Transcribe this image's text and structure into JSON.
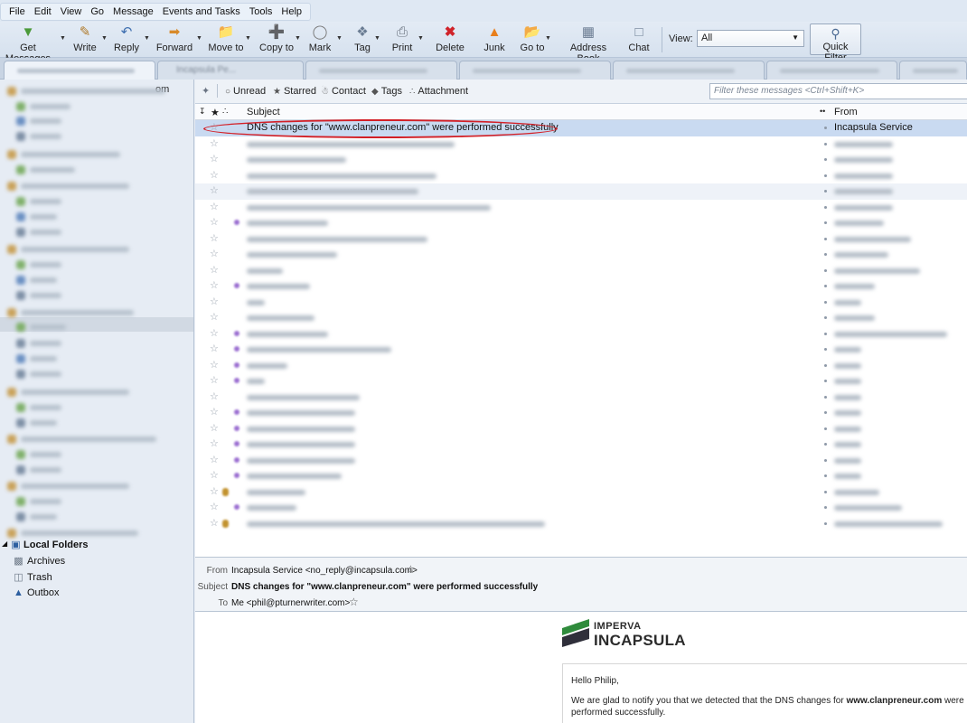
{
  "menus": [
    "File",
    "Edit",
    "View",
    "Go",
    "Message",
    "Events and Tasks",
    "Tools",
    "Help"
  ],
  "toolbar": {
    "buttons": [
      "Get Messages",
      "Write",
      "Reply",
      "Forward",
      "Move to",
      "Copy to",
      "Mark",
      "Tag",
      "Print",
      "Delete",
      "Junk",
      "Go to",
      "Address Book",
      "Chat"
    ],
    "view_label": "View:",
    "view_value": "All",
    "quick_filter": "Quick Filter"
  },
  "tabs": [
    "",
    "Incapsula Pe..."
  ],
  "folders": {
    "account_suffix": "om",
    "local_folders": "Local Folders",
    "items": [
      "Archives",
      "Trash",
      "Outbox"
    ]
  },
  "quick_filter_bar": {
    "items": [
      "Unread",
      "Starred",
      "Contact",
      "Tags",
      "Attachment"
    ],
    "placeholder": "Filter these messages <Ctrl+Shift+K>"
  },
  "thread": {
    "columns": {
      "subject": "Subject",
      "from": "From"
    },
    "selected_subject": "DNS changes for \"www.clanpreneur.com\" were performed successfully",
    "selected_from": "Incapsula Service"
  },
  "message": {
    "from_label": "From",
    "from_value": "Incapsula Service <no_reply@incapsula.com>",
    "subject_label": "Subject",
    "subject_value": "DNS changes for \"www.clanpreneur.com\" were performed successfully",
    "to_label": "To",
    "to_value": "Me <phil@pturnerwriter.com>",
    "logo_top": "IMPERVA",
    "logo_bottom": "INCAPSULA",
    "greeting": "Hello Philip,",
    "body_line1_pre": "We are glad to notify you that we detected that the DNS changes for ",
    "body_domain": "www.clanpreneur.com",
    "body_line1_post": " were",
    "body_line2": "performed successfully."
  },
  "colors": {
    "selection": "#c9daf1",
    "highlight_ellipse": "#d31f26",
    "delete_icon": "#d0232a",
    "junk_icon": "#e87f1c",
    "tag_purple": "#9b6fd1"
  }
}
